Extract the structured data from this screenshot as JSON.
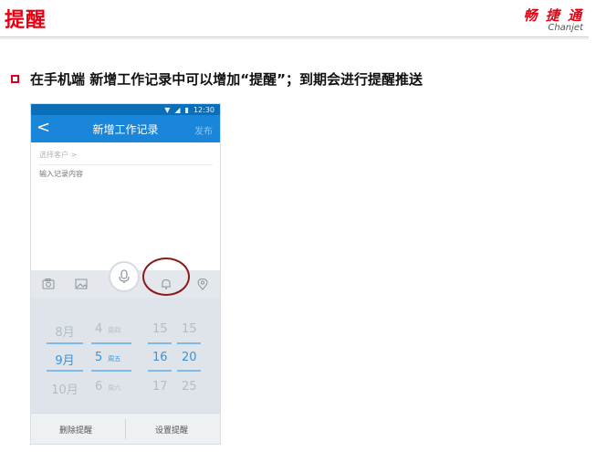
{
  "slide": {
    "title": "提醒",
    "brand_cn": "畅 捷 通",
    "brand_en": "Chanjet",
    "bullet": "在手机端 新增工作记录中可以增加“提醒”；到期会进行提醒推送"
  },
  "phone": {
    "status": {
      "time": "12:30"
    },
    "nav": {
      "back": "<",
      "title": "新增工作记录",
      "publish": "发布"
    },
    "customer_label": "选择客户 >",
    "record_placeholder": "输入记录内容",
    "toolbar": {
      "icons": [
        "camera-icon",
        "image-icon",
        "microphone-icon",
        "bell-icon",
        "location-icon"
      ]
    },
    "picker": {
      "months": [
        "8月",
        "9月",
        "10月"
      ],
      "days": [
        "4",
        "5",
        "6"
      ],
      "weekdays": [
        "周四",
        "周五",
        "周六"
      ],
      "hours": [
        "15",
        "16",
        "17"
      ],
      "minutes": [
        "15",
        "20",
        "25"
      ],
      "selected_index": 1
    },
    "buttons": {
      "delete": "删除提醒",
      "set": "设置提醒"
    }
  },
  "colors": {
    "accent": "#e60012",
    "nav": "#1a86d9",
    "highlight_circle": "#8b1a1a",
    "picker_selected": "#3b93d8"
  }
}
